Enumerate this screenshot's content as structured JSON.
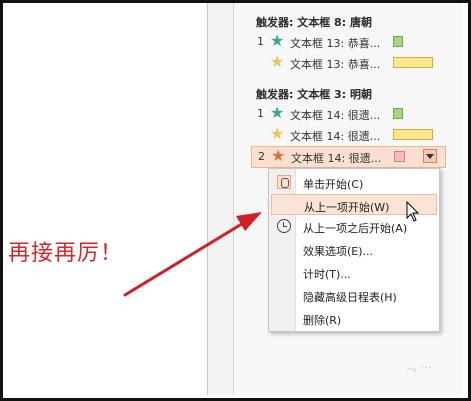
{
  "slide": {
    "text": "再接再厉！"
  },
  "animation_pane": {
    "groups": [
      {
        "trigger": "触发器: 文本框 8: 唐朝",
        "items": [
          {
            "num": "1",
            "star": "teal",
            "label": "文本框 13: 恭喜...",
            "bar": "green"
          },
          {
            "num": "",
            "star": "gold",
            "label": "文本框 13: 恭喜...",
            "bar": "yellow"
          }
        ]
      },
      {
        "trigger": "触发器: 文本框 3: 明朝",
        "items": [
          {
            "num": "1",
            "star": "teal",
            "label": "文本框 14: 很遗...",
            "bar": "green"
          },
          {
            "num": "",
            "star": "gold",
            "label": "文本框 14: 很遗...",
            "bar": "yellow"
          },
          {
            "num": "2",
            "star": "orange",
            "label": "文本框 14: 很遗...",
            "bar": "pink",
            "selected": true
          }
        ]
      }
    ]
  },
  "context_menu": {
    "items": [
      {
        "label": "单击开始(C)",
        "icon": "mouse-icon"
      },
      {
        "label": "从上一项开始(W)",
        "icon": "",
        "hover": true
      },
      {
        "label": "从上一项之后开始(A)",
        "icon": "clock-icon"
      },
      {
        "label": "效果选项(E)..."
      },
      {
        "label": "计时(T)..."
      },
      {
        "label": "隐藏高级日程表(H)"
      },
      {
        "label": "删除(R)"
      }
    ]
  },
  "colors": {
    "annotation_arrow": "#d11f26",
    "slide_text": "#d5262b",
    "selected_row_bg": "#fbe0d1"
  }
}
